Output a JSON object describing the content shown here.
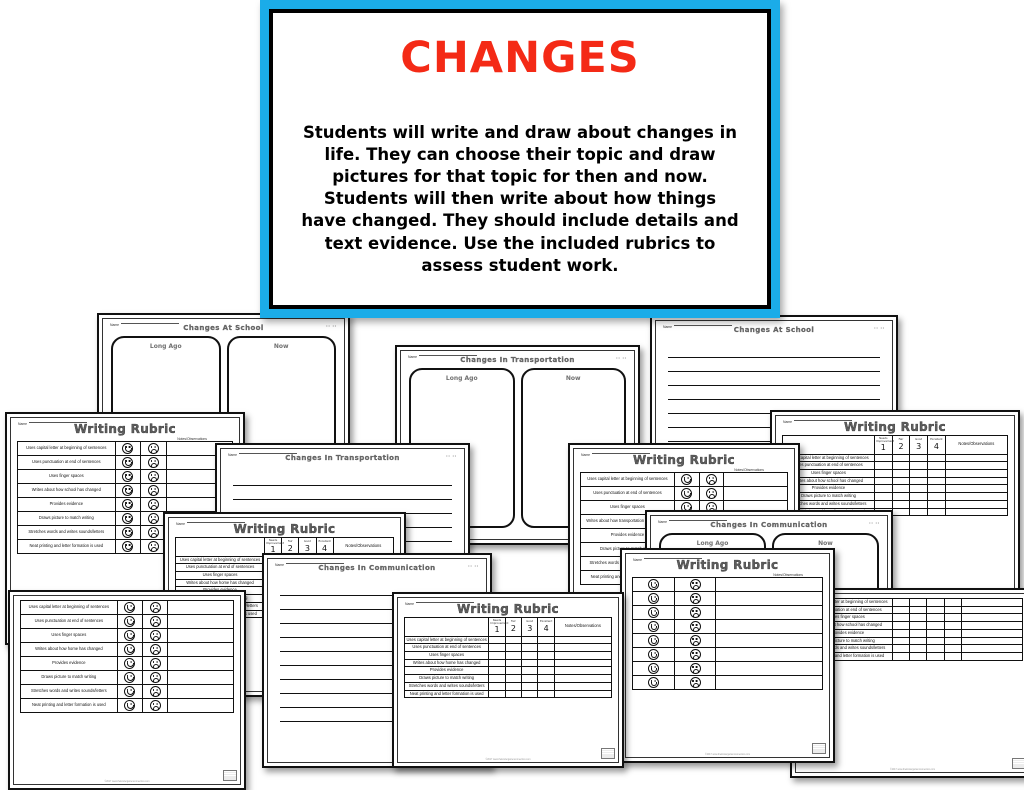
{
  "cover": {
    "title": "CHANGES",
    "body": "Students will write and draw about changes in life. They can choose their topic and draw pictures for that topic for then and now.  Students will then write about how things have changed. They should include details and text evidence. Use the included rubrics to assess student work.",
    "border_color": "#1BACE8",
    "title_color": "#F42A16"
  },
  "labels": {
    "name": "Name",
    "long_ago": "Long Ago",
    "now": "Now",
    "rubric_title": "Writing Rubric",
    "notes_header": "Notes/Observations",
    "corner_dots": "•• ••",
    "credit": "©2017 www.thekindergartenconnection.com"
  },
  "scale": {
    "headers": [
      "Needs Improvement",
      "Fair",
      "Good",
      "Excellent"
    ],
    "numbers": [
      "1",
      "2",
      "3",
      "4"
    ],
    "faces": [
      "smiley-face",
      "frowny-face"
    ]
  },
  "criteria": {
    "school": [
      "Uses capital letter at beginning of  sentences",
      "Uses punctuation at end of sentences",
      "Uses finger spaces",
      "Writes about how school has changed",
      "Provides evidence",
      "Draws picture to match writing",
      "Stretches words and writes sounds/letters",
      "Neat printing and letter formation is used"
    ],
    "home": [
      "Uses capital letter at beginning of  sentences",
      "Uses punctuation at end of sentences",
      "Uses finger spaces",
      "Writes about how home has changed",
      "Provides evidence",
      "Draws picture to match writing",
      "Stretches words and writes sounds/letters",
      "Neat printing and letter formation is used"
    ],
    "transportation": [
      "Uses capital letter at beginning of  sentences",
      "Uses punctuation at end of sentences",
      "Uses finger spaces",
      "Writes about how transportation has changed",
      "Provides evidence",
      "Draws picture to match writing",
      "Stretches words and writes sounds/letters",
      "Neat printing and letter formation is used"
    ]
  },
  "sheets": {
    "school_picture": {
      "title": "Changes At School"
    },
    "school_lined": {
      "title": "Changes At School"
    },
    "transportation_picture": {
      "title": "Changes In Transportation"
    },
    "transportation_lined": {
      "title": "Changes In Transportation"
    },
    "communication_picture": {
      "title": "Changes In Communication"
    },
    "communication_lined": {
      "title": "Changes In Communication"
    }
  }
}
